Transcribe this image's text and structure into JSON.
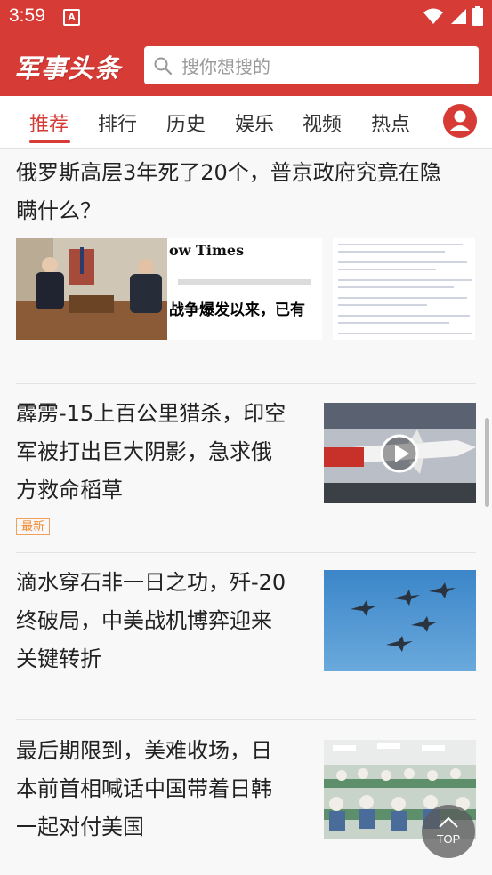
{
  "status_bar": {
    "time": "3:59",
    "notification_glyph": "A",
    "icons": [
      "wifi-icon",
      "signal-icon",
      "battery-icon"
    ]
  },
  "header": {
    "logo_text": "军事头条",
    "search_placeholder": "搜你想搜的",
    "brand_color": "#d63b35"
  },
  "tabs": [
    {
      "label": "推荐",
      "active": true
    },
    {
      "label": "排行",
      "active": false
    },
    {
      "label": "历史",
      "active": false
    },
    {
      "label": "娱乐",
      "active": false
    },
    {
      "label": "视频",
      "active": false
    },
    {
      "label": "热点",
      "active": false
    }
  ],
  "articles": [
    {
      "title_lines": [
        "俄罗斯高层3年死了20个，普京政府究竟在隐",
        "瞒什么？"
      ],
      "images": [
        {
          "type": "meeting-photo"
        },
        {
          "type": "news-screenshot",
          "masthead": "ow Times",
          "headline": "战争爆发以来，已有"
        },
        {
          "type": "document-screenshot"
        }
      ]
    },
    {
      "title_lines": [
        "霹雳-15上百公里猎杀，印空",
        "军被打出巨大阴影，急求俄",
        "方救命稻草"
      ],
      "badge": "最新",
      "has_video": true
    },
    {
      "title_lines": [
        "滴水穿石非一日之功，歼-20",
        "终破局，中美战机博弈迎来",
        "关键转折"
      ]
    },
    {
      "title_lines": [
        "最后期限到，美难收场，日",
        "本前首相喊话中国带着日韩",
        "一起对付美国"
      ]
    }
  ],
  "top_button": {
    "label": "TOP"
  }
}
